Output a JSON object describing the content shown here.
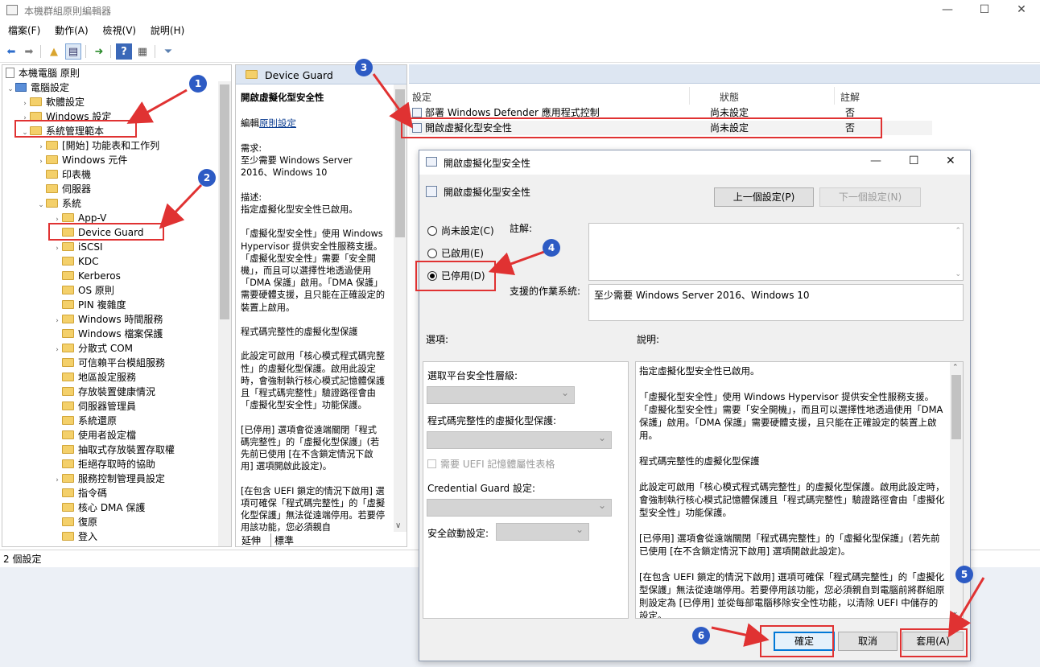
{
  "window": {
    "title": "本機群組原則編輯器",
    "controls": {
      "minimize": "—",
      "maximize": "☐",
      "close": "✕"
    }
  },
  "menu": [
    "檔案(F)",
    "動作(A)",
    "檢視(V)",
    "說明(H)"
  ],
  "tree": {
    "root": "本機電腦 原則",
    "computer_config": "電腦設定",
    "items": [
      {
        "label": "軟體設定"
      },
      {
        "label": "Windows 設定"
      },
      {
        "label": "系統管理範本"
      },
      {
        "label": "[開始] 功能表和工作列"
      },
      {
        "label": "Windows 元件"
      },
      {
        "label": "印表機"
      },
      {
        "label": "伺服器"
      },
      {
        "label": "系統"
      },
      {
        "label": "App-V"
      },
      {
        "label": "Device Guard"
      },
      {
        "label": "iSCSI"
      },
      {
        "label": "KDC"
      },
      {
        "label": "Kerberos"
      },
      {
        "label": "OS 原則"
      },
      {
        "label": "PIN 複雜度"
      },
      {
        "label": "Windows 時間服務"
      },
      {
        "label": "Windows 檔案保護"
      },
      {
        "label": "分散式 COM"
      },
      {
        "label": "可信賴平台模組服務"
      },
      {
        "label": "地區設定服務"
      },
      {
        "label": "存放裝置健康情況"
      },
      {
        "label": "伺服器管理員"
      },
      {
        "label": "系統還原"
      },
      {
        "label": "使用者設定檔"
      },
      {
        "label": "抽取式存放裝置存取權"
      },
      {
        "label": "拒絕存取時的協助"
      },
      {
        "label": "服務控制管理員設定"
      },
      {
        "label": "指令碼"
      },
      {
        "label": "核心 DMA 保護"
      },
      {
        "label": "復原"
      },
      {
        "label": "登入"
      }
    ]
  },
  "desc_pane": {
    "header": "Device Guard",
    "heading": "開啟虛擬化型安全性",
    "edit_prefix": "編輯",
    "edit_link": "原則設定",
    "body": "需求:\n至少需要 Windows Server 2016、Windows 10\n\n描述:\n指定虛擬化型安全性已啟用。\n\n「虛擬化型安全性」使用 Windows Hypervisor 提供安全性服務支援。「虛擬化型安全性」需要「安全開機」，而且可以選擇性地透過使用「DMA 保護」啟用。「DMA 保護」需要硬體支援，且只能在正確設定的裝置上啟用。\n\n程式碼完整性的虛擬化型保護\n\n此設定可啟用「核心模式程式碼完整性」的虛擬化型保護。啟用此設定時，會強制執行核心模式記憶體保護且「程式碼完整性」驗證路徑會由「虛擬化型安全性」功能保護。\n\n[已停用] 選項會從遠端關閉「程式碼完整性」的「虛擬化型保護」(若先前已使用 [在不含鎖定情況下啟用] 選項開啟此設定)。\n\n[在包含 UEFI 鎖定的情況下啟用] 選項可確保「程式碼完整性」的「虛擬化型保護」無法從遠端停用。若要停用該功能，您必須親自",
    "tabs": [
      "延伸",
      "標準"
    ]
  },
  "list": {
    "columns": [
      "設定",
      "狀態",
      "註解"
    ],
    "rows": [
      {
        "name": "部署 Windows Defender 應用程式控制",
        "state": "尚未設定",
        "comment": "否"
      },
      {
        "name": "開啟虛擬化型安全性",
        "state": "尚未設定",
        "comment": "否"
      }
    ]
  },
  "status_bar": "2 個設定",
  "dialog": {
    "title": "開啟虛擬化型安全性",
    "subtitle": "開啟虛擬化型安全性",
    "prev_button": "上一個設定(P)",
    "next_button": "下一個設定(N)",
    "radio": [
      "尚未設定(C)",
      "已啟用(E)",
      "已停用(D)"
    ],
    "selected_radio": "已停用(D)",
    "comment_label": "註解:",
    "supported_label": "支援的作業系統:",
    "supported_value": "至少需要 Windows Server 2016、Windows 10",
    "options_label": "選項:",
    "help_label": "說明:",
    "options": {
      "platform_label": "選取平台安全性層級:",
      "code_integrity_label": "程式碼完整性的虛擬化型保護:",
      "uefi_checkbox": "需要 UEFI 記憶體屬性表格",
      "credential_guard_label": "Credential Guard 設定:",
      "secure_launch_label": "安全啟動設定:"
    },
    "help_text": "指定虛擬化型安全性已啟用。\n\n「虛擬化型安全性」使用 Windows Hypervisor 提供安全性服務支援。「虛擬化型安全性」需要「安全開機」，而且可以選擇性地透過使用「DMA 保護」啟用。「DMA 保護」需要硬體支援，且只能在正確設定的裝置上啟用。\n\n程式碼完整性的虛擬化型保護\n\n此設定可啟用「核心模式程式碼完整性」的虛擬化型保護。啟用此設定時，會強制執行核心模式記憶體保護且「程式碼完整性」驗證路徑會由「虛擬化型安全性」功能保護。\n\n[已停用] 選項會從遠端關閉「程式碼完整性」的「虛擬化型保護」(若先前已使用 [在不含鎖定情況下啟用] 選項開啟此設定)。\n\n[在包含 UEFI 鎖定的情況下啟用] 選項可確保「程式碼完整性」的「虛擬化型保護」無法從遠端停用。若要停用該功能，您必須親自到電腦前將群組原則設定為 [已停用] 並從每部電腦移除安全性功能，以清除 UEFI 中儲存的設定。",
    "ok_button": "確定",
    "cancel_button": "取消",
    "apply_button": "套用(A)"
  },
  "annotations": [
    "1",
    "2",
    "3",
    "4",
    "5",
    "6"
  ],
  "colors": {
    "annotation_red": "#e03232",
    "badge_blue": "#2d5bc4",
    "selection": "#cce8ff"
  }
}
